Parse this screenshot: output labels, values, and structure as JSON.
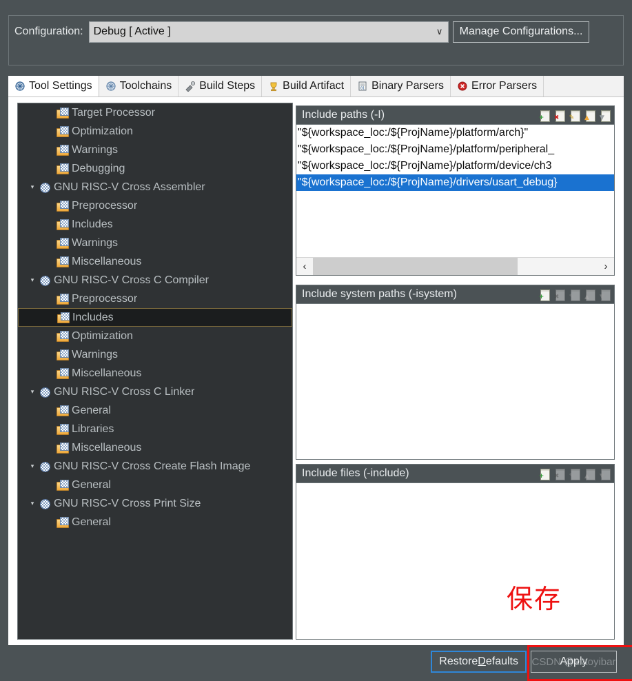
{
  "config": {
    "label": "Configuration:",
    "value": "Debug  [ Active ]",
    "chevron": "∨",
    "manage_button": "Manage Configurations..."
  },
  "tabs": [
    {
      "label": "Tool Settings",
      "icon": "tool-settings-icon",
      "active": true
    },
    {
      "label": "Toolchains",
      "icon": "toolchains-icon",
      "active": false
    },
    {
      "label": "Build Steps",
      "icon": "build-steps-icon",
      "active": false
    },
    {
      "label": "Build Artifact",
      "icon": "build-artifact-icon",
      "active": false
    },
    {
      "label": "Binary Parsers",
      "icon": "binary-parsers-icon",
      "active": false
    },
    {
      "label": "Error Parsers",
      "icon": "error-parsers-icon",
      "active": false
    }
  ],
  "tree": [
    {
      "label": "Target Processor",
      "depth": 1,
      "icon": "folder-page-icon",
      "twisty": "",
      "selected": false
    },
    {
      "label": "Optimization",
      "depth": 1,
      "icon": "folder-page-icon",
      "twisty": "",
      "selected": false
    },
    {
      "label": "Warnings",
      "depth": 1,
      "icon": "folder-page-icon",
      "twisty": "",
      "selected": false
    },
    {
      "label": "Debugging",
      "depth": 1,
      "icon": "folder-page-icon",
      "twisty": "",
      "selected": false
    },
    {
      "label": "GNU RISC-V Cross Assembler",
      "depth": 0,
      "icon": "globe-tool-icon",
      "twisty": "▾",
      "selected": false
    },
    {
      "label": "Preprocessor",
      "depth": 1,
      "icon": "folder-page-icon",
      "twisty": "",
      "selected": false
    },
    {
      "label": "Includes",
      "depth": 1,
      "icon": "folder-page-icon",
      "twisty": "",
      "selected": false
    },
    {
      "label": "Warnings",
      "depth": 1,
      "icon": "folder-page-icon",
      "twisty": "",
      "selected": false
    },
    {
      "label": "Miscellaneous",
      "depth": 1,
      "icon": "folder-page-icon",
      "twisty": "",
      "selected": false
    },
    {
      "label": "GNU RISC-V Cross C Compiler",
      "depth": 0,
      "icon": "globe-tool-icon",
      "twisty": "▾",
      "selected": false
    },
    {
      "label": "Preprocessor",
      "depth": 1,
      "icon": "folder-page-icon",
      "twisty": "",
      "selected": false
    },
    {
      "label": "Includes",
      "depth": 1,
      "icon": "folder-page-icon",
      "twisty": "",
      "selected": true
    },
    {
      "label": "Optimization",
      "depth": 1,
      "icon": "folder-page-icon",
      "twisty": "",
      "selected": false
    },
    {
      "label": "Warnings",
      "depth": 1,
      "icon": "folder-page-icon",
      "twisty": "",
      "selected": false
    },
    {
      "label": "Miscellaneous",
      "depth": 1,
      "icon": "folder-page-icon",
      "twisty": "",
      "selected": false
    },
    {
      "label": "GNU RISC-V Cross C Linker",
      "depth": 0,
      "icon": "globe-tool-icon",
      "twisty": "▾",
      "selected": false
    },
    {
      "label": "General",
      "depth": 1,
      "icon": "folder-page-icon",
      "twisty": "",
      "selected": false
    },
    {
      "label": "Libraries",
      "depth": 1,
      "icon": "folder-page-icon",
      "twisty": "",
      "selected": false
    },
    {
      "label": "Miscellaneous",
      "depth": 1,
      "icon": "folder-page-icon",
      "twisty": "",
      "selected": false
    },
    {
      "label": "GNU RISC-V Cross Create Flash Image",
      "depth": 0,
      "icon": "globe-tool-icon",
      "twisty": "▾",
      "selected": false
    },
    {
      "label": "General",
      "depth": 1,
      "icon": "folder-page-icon",
      "twisty": "",
      "selected": false
    },
    {
      "label": "GNU RISC-V Cross Print Size",
      "depth": 0,
      "icon": "globe-tool-icon",
      "twisty": "▾",
      "selected": false
    },
    {
      "label": "General",
      "depth": 1,
      "icon": "folder-page-icon",
      "twisty": "",
      "selected": false
    }
  ],
  "panels": [
    {
      "title": "Include paths (-I)",
      "tools": [
        {
          "name": "add-icon",
          "glyph": "+",
          "enabled": true
        },
        {
          "name": "delete-icon",
          "glyph": "✖",
          "enabled": true
        },
        {
          "name": "edit-icon",
          "glyph": "✎",
          "enabled": true
        },
        {
          "name": "move-up-icon",
          "glyph": "▲",
          "enabled": true
        },
        {
          "name": "move-down-icon",
          "glyph": "▼",
          "enabled": true
        }
      ],
      "rows": [
        {
          "text": "\"${workspace_loc:/${ProjName}/platform/arch}\"",
          "selected": false
        },
        {
          "text": "\"${workspace_loc:/${ProjName}/platform/peripheral_",
          "selected": false
        },
        {
          "text": "\"${workspace_loc:/${ProjName}/platform/device/ch3",
          "selected": false
        },
        {
          "text": "\"${workspace_loc:/${ProjName}/drivers/usart_debug}",
          "selected": true
        }
      ],
      "scrollbar": {
        "left_arrow": "‹",
        "right_arrow": "›"
      }
    },
    {
      "title": "Include system paths (-isystem)",
      "tools": [
        {
          "name": "add-icon",
          "glyph": "+",
          "enabled": true
        },
        {
          "name": "delete-icon",
          "glyph": "✖",
          "enabled": false
        },
        {
          "name": "edit-icon",
          "glyph": "✎",
          "enabled": false
        },
        {
          "name": "move-up-icon",
          "glyph": "▲",
          "enabled": false
        },
        {
          "name": "move-down-icon",
          "glyph": "▼",
          "enabled": false
        }
      ],
      "rows": []
    },
    {
      "title": "Include files (-include)",
      "tools": [
        {
          "name": "add-icon",
          "glyph": "+",
          "enabled": true
        },
        {
          "name": "delete-icon",
          "glyph": "✖",
          "enabled": false
        },
        {
          "name": "edit-icon",
          "glyph": "✎",
          "enabled": false
        },
        {
          "name": "move-up-icon",
          "glyph": "▲",
          "enabled": false
        },
        {
          "name": "move-down-icon",
          "glyph": "▼",
          "enabled": false
        }
      ],
      "rows": []
    }
  ],
  "annotation": {
    "text": "保存",
    "color": "#ee1111"
  },
  "buttons": {
    "restore_defaults_pre": "Restore ",
    "restore_defaults_key": "D",
    "restore_defaults_post": "efaults",
    "apply": "Apply"
  },
  "watermark": "CSDN @xiaoyibar"
}
